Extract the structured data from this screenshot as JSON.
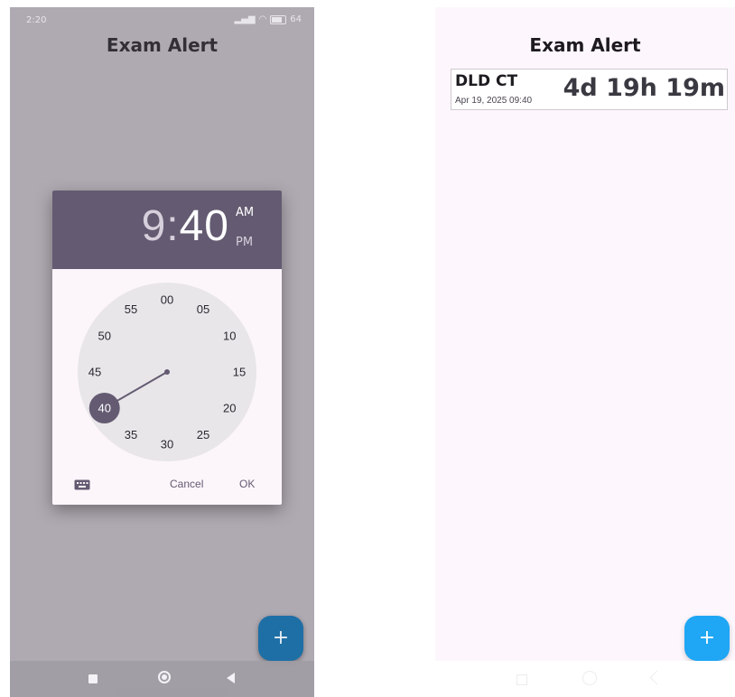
{
  "left_screen": {
    "status_bar": {
      "time": "2:20",
      "battery": "64"
    },
    "app_title": "Exam Alert",
    "time_picker": {
      "hour": "9",
      "separator": ":",
      "minute": "40",
      "am_label": "AM",
      "pm_label": "PM",
      "selected_period": "AM",
      "clock_labels": [
        "00",
        "05",
        "10",
        "15",
        "20",
        "25",
        "30",
        "35",
        "40",
        "45",
        "50",
        "55"
      ],
      "selected_minute_label": "40",
      "cancel_label": "Cancel",
      "ok_label": "OK",
      "keyboard_icon": "keyboard-icon"
    },
    "fab_label": "+",
    "colors": {
      "header": "#645b72",
      "fab": "#1e6fa6"
    }
  },
  "right_screen": {
    "app_title": "Exam Alert",
    "exam": {
      "name": "DLD CT",
      "date": "Apr 19, 2025 09:40",
      "countdown": "4d 19h 19m"
    },
    "fab_label": "+",
    "colors": {
      "fab": "#1fa6f5"
    }
  }
}
